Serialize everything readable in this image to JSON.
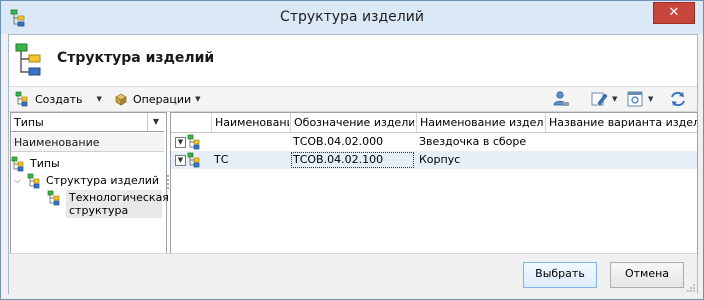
{
  "window": {
    "title": "Структура изделий",
    "close_symbol": "✕"
  },
  "header": {
    "title": "Структура изделий"
  },
  "toolbar": {
    "create_label": "Создать",
    "operations_label": "Операции",
    "right_icons": [
      "user-search-icon",
      "edit-icon",
      "view-icon",
      "refresh-icon"
    ]
  },
  "left_panel": {
    "combo_value": "Типы",
    "column_header": "Наименование",
    "tree": {
      "root": "Типы",
      "child": "Структура изделий",
      "grandchild": "Технологическая структура"
    }
  },
  "grid": {
    "columns": [
      "Наименование",
      "Обозначение изделия",
      "Наименование изделия",
      "Название варианта изделия"
    ],
    "rows": [
      {
        "name": "",
        "designation": "ТСОВ.04.02.000",
        "product_name": "Звездочка в сборе",
        "variant": ""
      },
      {
        "name": "ТС",
        "designation": "ТСОВ.04.02.100",
        "product_name": "Корпус",
        "variant": ""
      }
    ]
  },
  "footer": {
    "select_label": "Выбрать",
    "cancel_label": "Отмена"
  },
  "colors": {
    "accent": "#3a73c4",
    "selected_row": "#e6eef8",
    "close": "#c7463b"
  }
}
